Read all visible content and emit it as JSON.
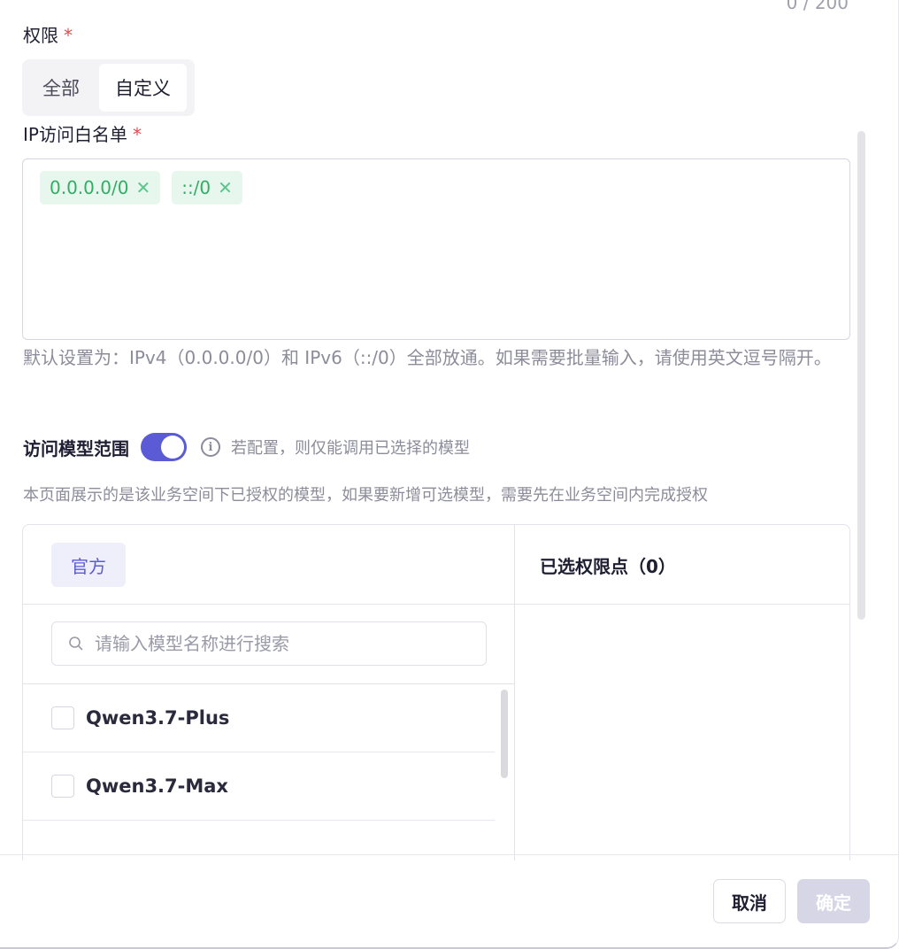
{
  "top_counter": "0 / 200",
  "permission": {
    "label": "权限",
    "required_mark": "*",
    "options": [
      "全部",
      "自定义"
    ],
    "selected": "自定义"
  },
  "ip_whitelist": {
    "label": "IP访问白名单",
    "required_mark": "*",
    "tags": [
      "0.0.0.0/0",
      "::/0"
    ],
    "help": "默认设置为：IPv4（0.0.0.0/0）和 IPv6（::/0）全部放通。如果需要批量输入，请使用英文逗号隔开。"
  },
  "model_scope": {
    "label": "访问模型范围",
    "enabled": true,
    "hint": "若配置，则仅能调用已选择的模型",
    "sub_help": "本页面展示的是该业务空间下已授权的模型，如果要新增可选模型，需要先在业务空间内完成授权"
  },
  "transfer": {
    "left_tab": "官方",
    "search_placeholder": "请输入模型名称进行搜索",
    "items": [
      "Qwen3.7-Plus",
      "Qwen3.7-Max"
    ],
    "right_title": "已选权限点（0）"
  },
  "footer": {
    "cancel_label": "取消",
    "ok_label": "确定"
  },
  "colors": {
    "accent": "#5b5bd6",
    "tag_bg": "#e8f7ee",
    "tag_text": "#2fae64",
    "required": "#e5484d"
  }
}
